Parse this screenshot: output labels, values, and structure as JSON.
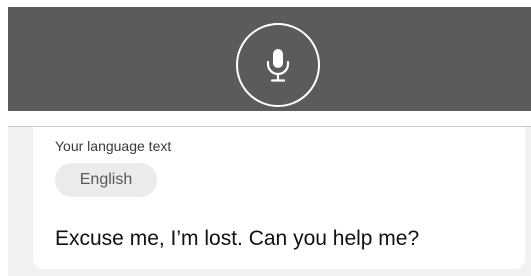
{
  "mic": {
    "icon": "microphone-icon"
  },
  "card": {
    "section_label": "Your language text",
    "language_chip": "English",
    "phrase": "Excuse me, I’m lost. Can you help me?"
  },
  "colors": {
    "mic_bar_bg": "#5b5b5b",
    "chip_bg": "#ebebeb",
    "card_bg": "#ffffff",
    "area_bg": "#f1f1f1"
  }
}
